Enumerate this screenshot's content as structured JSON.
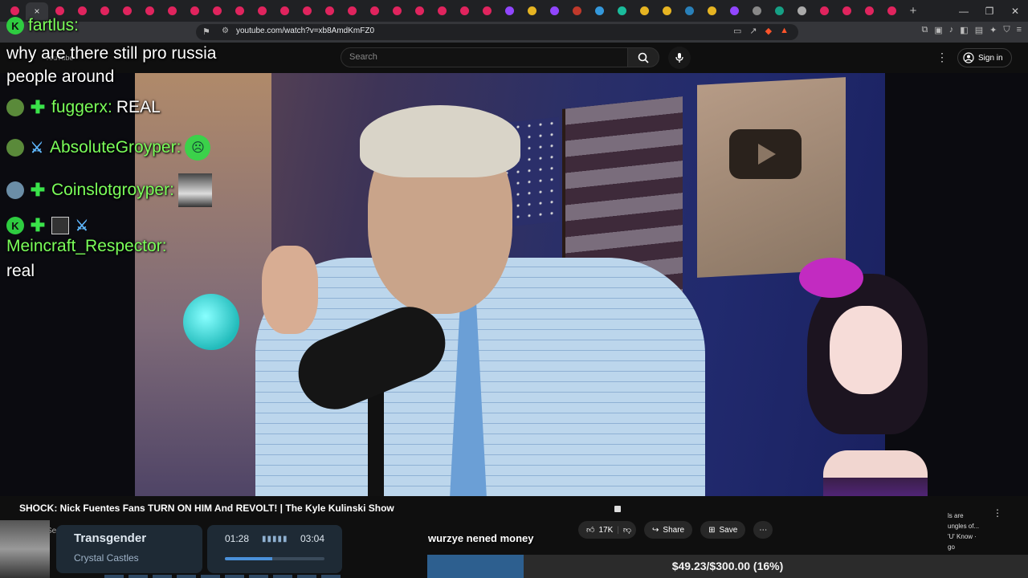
{
  "browser": {
    "url": "youtube.com/watch?v=xb8AmdKmFZ0",
    "active_tab_close": "×",
    "new_tab": "+",
    "window_controls": [
      "—",
      "❐",
      "✕"
    ]
  },
  "youtube": {
    "logo_text": "YouTube",
    "search_placeholder": "Search",
    "sign_in": "Sign in",
    "video_title": "SHOCK: Nick Fuentes Fans TURN ON HIM And REVOLT! | The Kyle Kulinski Show",
    "channel_name": "Secular Talk",
    "likes": "17K",
    "share": "Share",
    "save": "Save",
    "related_snippet": [
      "ls are",
      "ungles of...",
      "'U' Know ·",
      "go"
    ]
  },
  "chat": {
    "messages": [
      {
        "user": "fartlus:",
        "text": "why are there still pro russia people around",
        "badges": [
          "k"
        ]
      },
      {
        "user": "fuggerx:",
        "text": "REAL",
        "badges": [
          "frog",
          "plus"
        ]
      },
      {
        "user": "AbsoluteGroyper:",
        "text": "",
        "badges": [
          "frog",
          "sword"
        ],
        "emote": "frog"
      },
      {
        "user": "Coinslotgroyper:",
        "text": "",
        "badges": [
          "globe",
          "plus"
        ],
        "emote": "image"
      },
      {
        "user": "Meincraft_Respector:",
        "text": "real",
        "badges": [
          "k",
          "plus",
          "box",
          "sword"
        ]
      }
    ]
  },
  "music": {
    "song": "Transgender",
    "artist": "Crystal Castles",
    "current_time": "01:28",
    "total_time": "03:04",
    "progress": 0.478
  },
  "caption": "wurzye nened money",
  "goal": {
    "text": "$49.23/$300.00 (16%)",
    "progress": 0.16
  },
  "colors": {
    "chat_username": "#7bff5a",
    "goal_fill": "#2d5f8f",
    "music_accent": "#4a90d9"
  }
}
